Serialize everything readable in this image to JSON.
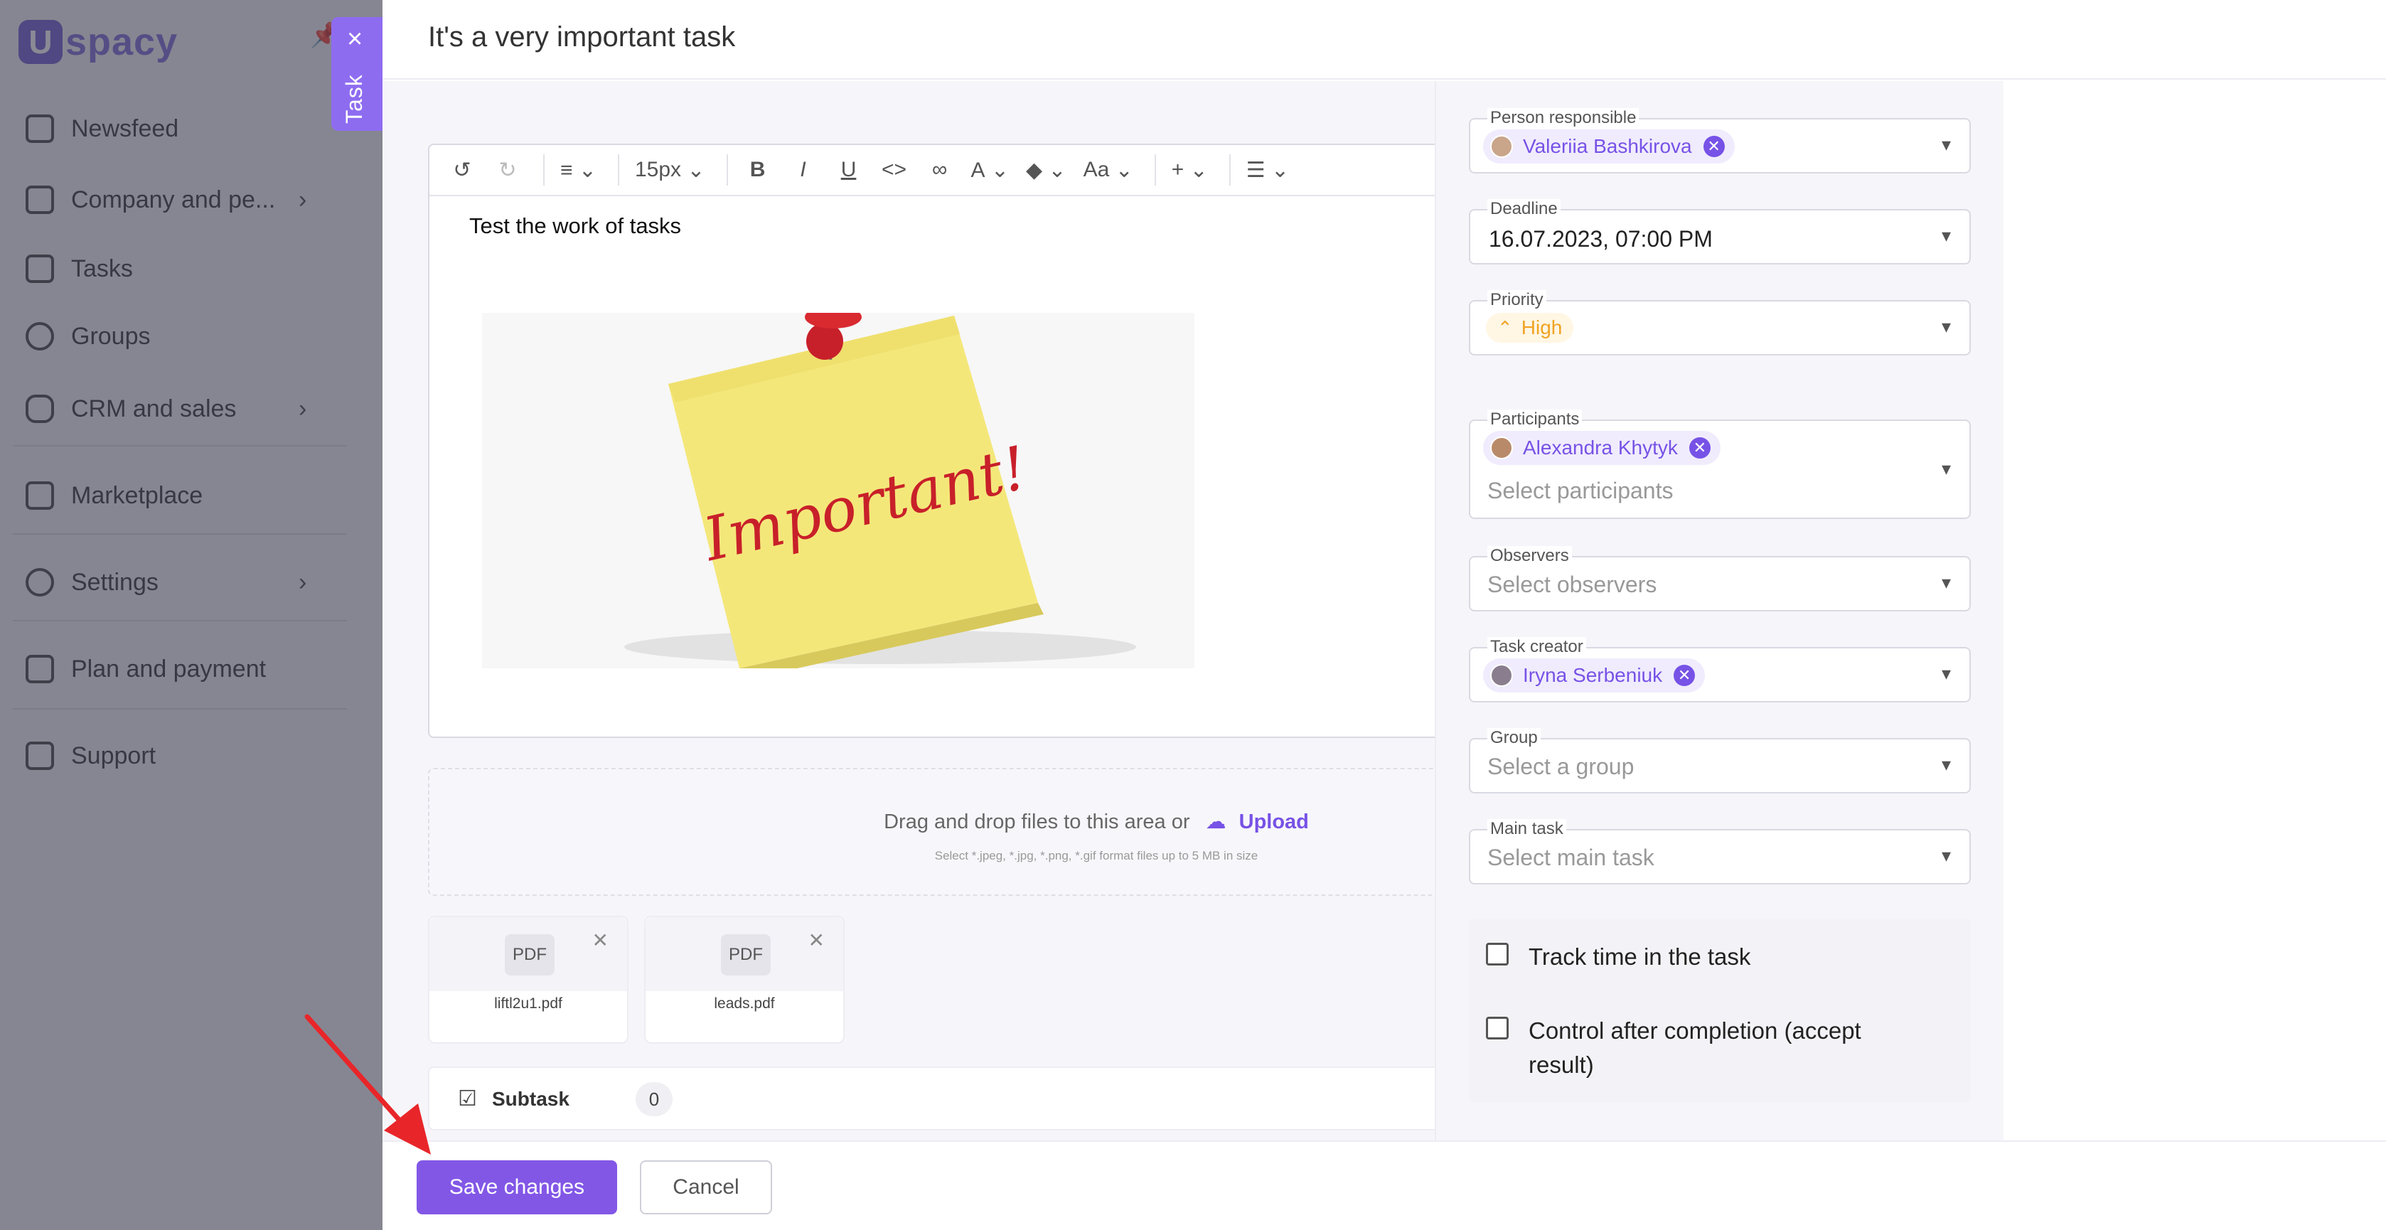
{
  "sidebar": {
    "brand": "spacy",
    "brand_mark": "U",
    "items": [
      {
        "label": "Newsfeed",
        "icon": "home-icon"
      },
      {
        "label": "Company and pe...",
        "icon": "building-icon",
        "has_children": true
      },
      {
        "label": "Tasks",
        "icon": "calendar-icon"
      },
      {
        "label": "Groups",
        "icon": "users-icon"
      },
      {
        "label": "CRM and sales",
        "icon": "database-icon",
        "has_children": true
      },
      {
        "label": "Marketplace",
        "icon": "store-icon"
      },
      {
        "label": "Settings",
        "icon": "gear-icon",
        "has_children": true
      },
      {
        "label": "Plan and payment",
        "icon": "wallet-icon"
      },
      {
        "label": "Support",
        "icon": "help-icon"
      }
    ]
  },
  "task_tab": {
    "label": "Task",
    "close": "×"
  },
  "header": {
    "title": "It's a very important task"
  },
  "editor": {
    "toolbar": {
      "font_size": "15px",
      "font_case": "Aa",
      "add": "+"
    },
    "text": "Test the work of tasks",
    "image_text": "Important!"
  },
  "upload": {
    "prompt": "Drag and drop files to this area or",
    "link": "Upload",
    "hint": "Select *.jpeg, *.jpg, *.png, *.gif format files up to 5 MB in size"
  },
  "files": [
    {
      "type": "PDF",
      "name": "liftl2u1.pdf"
    },
    {
      "type": "PDF",
      "name": "leads.pdf"
    }
  ],
  "subtask": {
    "label": "Subtask",
    "count": "0"
  },
  "footer": {
    "save": "Save changes",
    "cancel": "Cancel"
  },
  "fields": {
    "person_responsible": {
      "label": "Person responsible",
      "value": "Valeriia Bashkirova"
    },
    "deadline": {
      "label": "Deadline",
      "value": "16.07.2023, 07:00 PM"
    },
    "priority": {
      "label": "Priority",
      "value": "High",
      "color": "#f0a323"
    },
    "participants": {
      "label": "Participants",
      "value": "Alexandra Khytyk",
      "placeholder": "Select participants"
    },
    "observers": {
      "label": "Observers",
      "placeholder": "Select observers"
    },
    "task_creator": {
      "label": "Task creator",
      "value": "Iryna Serbeniuk"
    },
    "group": {
      "label": "Group",
      "placeholder": "Select a group"
    },
    "main_task": {
      "label": "Main task",
      "placeholder": "Select main task"
    }
  },
  "checkboxes": [
    {
      "label": "Track time in the task",
      "checked": false
    },
    {
      "label": "Control after completion (accept result)",
      "checked": false
    }
  ],
  "colors": {
    "accent": "#8257e6",
    "overlay": "#3c3c4e"
  }
}
